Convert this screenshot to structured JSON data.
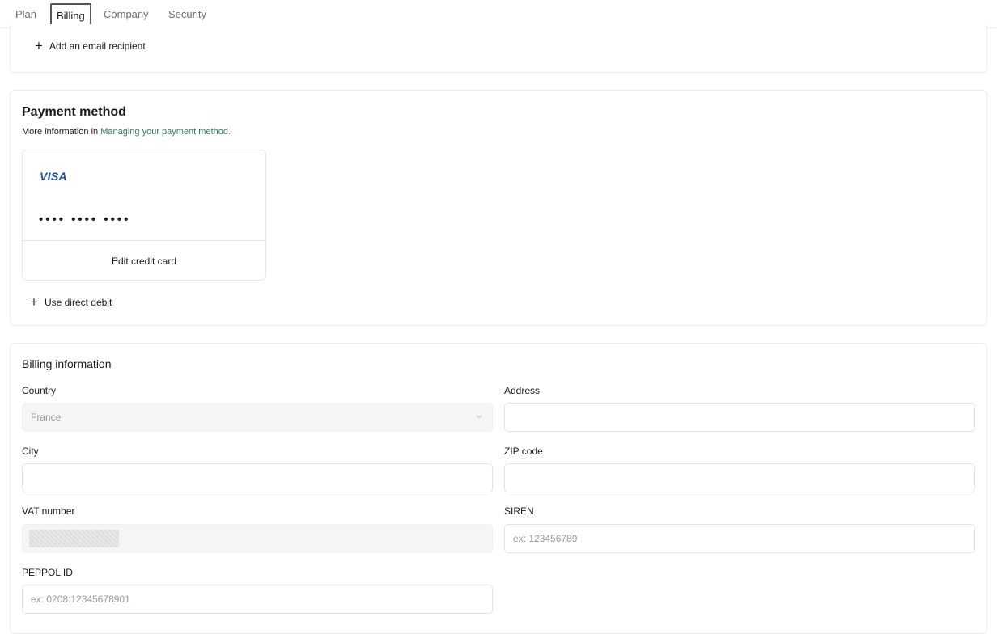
{
  "tabs": [
    "Plan",
    "Billing",
    "Company",
    "Security"
  ],
  "email_section": {
    "add_recipient_label": "Add an email recipient"
  },
  "payment": {
    "title": "Payment method",
    "subtitle_prefix": "More information in ",
    "subtitle_link": "Managing your payment method.",
    "card_brand": "VISA",
    "card_masked": "•••• •••• ••••",
    "edit_label": "Edit credit card",
    "direct_debit_label": "Use direct debit"
  },
  "billing": {
    "title": "Billing information",
    "country": {
      "label": "Country",
      "value": "France"
    },
    "address": {
      "label": "Address",
      "value": ""
    },
    "city": {
      "label": "City",
      "value": ""
    },
    "zip": {
      "label": "ZIP code",
      "value": ""
    },
    "vat": {
      "label": "VAT number",
      "value": ""
    },
    "siren": {
      "label": "SIREN",
      "placeholder": "ex: 123456789"
    },
    "peppol": {
      "label": "PEPPOL ID",
      "placeholder": "ex: 0208:12345678901"
    }
  },
  "colors": {
    "link": "#2f7a5b",
    "visa": "#1a4fa0",
    "border": "#ececec"
  }
}
